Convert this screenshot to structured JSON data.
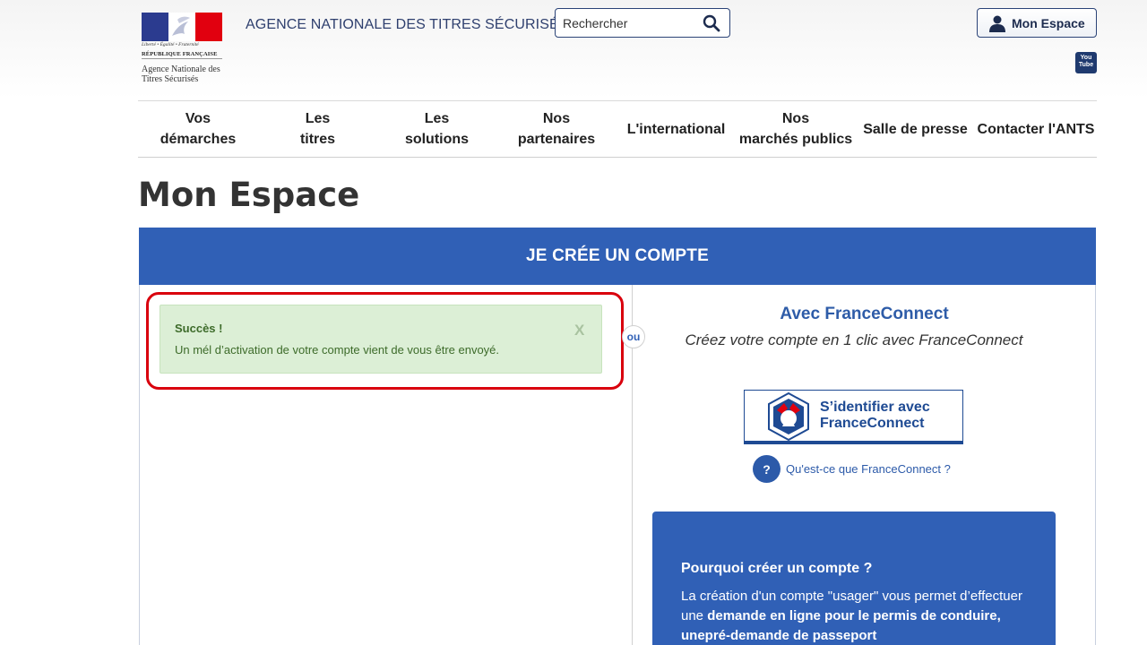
{
  "header": {
    "logo": {
      "motto": "Liberté • Égalité • Fraternité",
      "republic": "RÉPUBLIQUE FRANÇAISE",
      "name": "Agence Nationale des Titres Sécurisés"
    },
    "agency_title": "AGENCE NATIONALE DES TITRES SÉCURISÉS",
    "search": {
      "placeholder": "Rechercher",
      "value": ""
    },
    "account_button": "Mon Espace",
    "youtube": {
      "line1": "You",
      "line2": "Tube"
    }
  },
  "nav": {
    "items": [
      {
        "label": "Vos\ndémarches"
      },
      {
        "label": "Les\ntitres"
      },
      {
        "label": "Les\nsolutions"
      },
      {
        "label": "Nos\npartenaires"
      },
      {
        "label": "L'international"
      },
      {
        "label": "Nos\nmarchés publics"
      },
      {
        "label": "Salle de presse"
      },
      {
        "label": "Contacter l'ANTS"
      }
    ]
  },
  "page": {
    "title": "Mon Espace",
    "card_header": "JE CRÉE UN COMPTE",
    "alert": {
      "title": "Succès !",
      "message": "Un mél d’activation de votre compte vient de vous être envoyé.",
      "close": "X"
    },
    "separator": "ou",
    "franceconnect": {
      "title": "Avec FranceConnect",
      "subtitle": "Créez votre compte en 1 clic avec FranceConnect",
      "button_label": "S’identifier avec\nFranceConnect",
      "help_icon": "?",
      "help_link": "Qu'est-ce que FranceConnect ?"
    },
    "why": {
      "title": "Pourquoi créer un compte ?",
      "text_1": "La création d'un compte \"usager\" vous permet d’effectuer une ",
      "text_bold": "demande en ligne pour le permis de conduire, unepré-demande de passeport"
    }
  },
  "colors": {
    "primary": "#3060b6",
    "alert_bg": "#dcefd6",
    "alert_text": "#3d6b2a",
    "highlight": "#d9000d"
  }
}
